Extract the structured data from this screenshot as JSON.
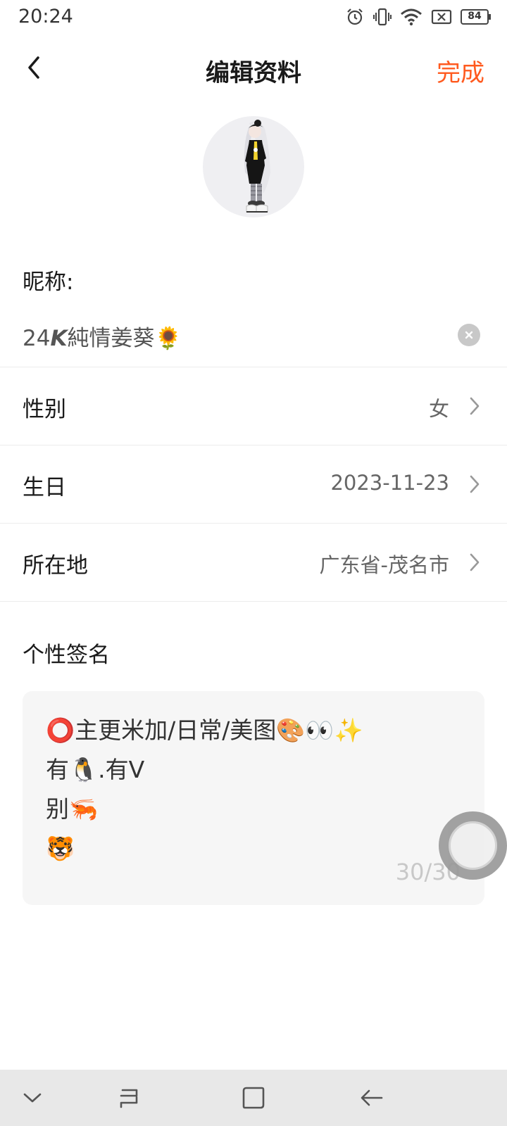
{
  "status_bar": {
    "time": "20:24",
    "battery": "84",
    "icons": [
      "alarm-icon",
      "vibrate-icon",
      "wifi-icon",
      "sim-disabled-icon",
      "battery-icon"
    ]
  },
  "header": {
    "title": "编辑资料",
    "back_icon": "back-chevron-icon",
    "done_label": "完成",
    "accent_color": "#ff5a1f"
  },
  "profile": {
    "avatar": "anime-character-avatar",
    "nickname_label": "昵称:",
    "nickname_value": "24𝙆純情姜葵🌻",
    "clear_icon": "clear-icon"
  },
  "fields": [
    {
      "label": "性别",
      "value": "女"
    },
    {
      "label": "生日",
      "value": "2023-11-23"
    },
    {
      "label": "所在地",
      "value": "广东省-茂名市"
    }
  ],
  "signature": {
    "label": "个性签名",
    "lines": [
      "⭕主更米加/日常/美图🎨👀✨",
      "有🐧.有V",
      "别🦐",
      "🐯"
    ],
    "counter": "30/30"
  },
  "bottom_nav": {
    "icons": [
      "collapse-down-icon",
      "recents-icon",
      "home-icon",
      "back-arrow-icon"
    ]
  }
}
